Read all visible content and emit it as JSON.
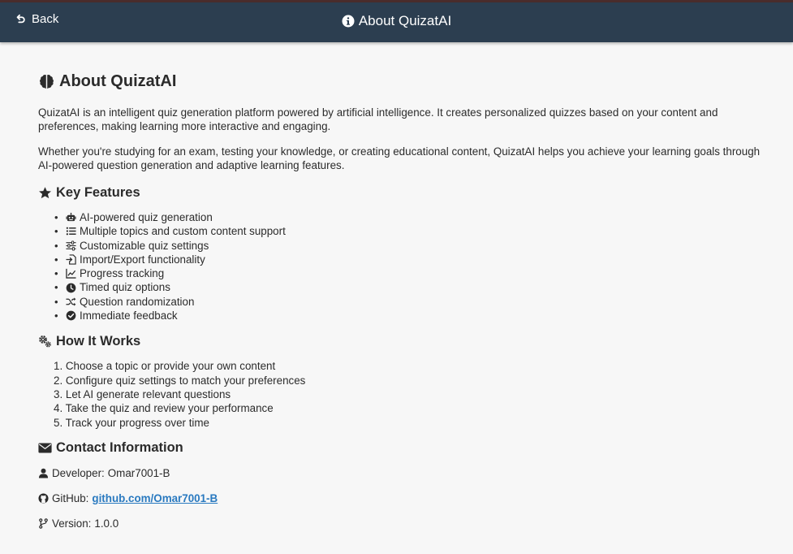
{
  "header": {
    "back_label": "Back",
    "title": "About QuizatAI"
  },
  "main": {
    "title": "About QuizatAI",
    "intro_1": "QuizatAI is an intelligent quiz generation platform powered by artificial intelligence. It creates personalized quizzes based on your content and preferences, making learning more interactive and engaging.",
    "intro_2": "Whether you're studying for an exam, testing your knowledge, or creating educational content, QuizatAI helps you achieve your learning goals through AI-powered question generation and adaptive learning features."
  },
  "features": {
    "heading": "Key Features",
    "items": [
      {
        "icon": "robot-icon",
        "label": "AI-powered quiz generation"
      },
      {
        "icon": "list-icon",
        "label": "Multiple topics and custom content support"
      },
      {
        "icon": "sliders-icon",
        "label": "Customizable quiz settings"
      },
      {
        "icon": "file-import-icon",
        "label": "Import/Export functionality"
      },
      {
        "icon": "chart-line-icon",
        "label": "Progress tracking"
      },
      {
        "icon": "clock-icon",
        "label": "Timed quiz options"
      },
      {
        "icon": "shuffle-icon",
        "label": "Question randomization"
      },
      {
        "icon": "check-circle-icon",
        "label": "Immediate feedback"
      }
    ]
  },
  "how": {
    "heading": "How It Works",
    "steps": [
      "1. Choose a topic or provide your own content",
      "2. Configure quiz settings to match your preferences",
      "3. Let AI generate relevant questions",
      "4. Take the quiz and review your performance",
      "5. Track your progress over time"
    ]
  },
  "contact": {
    "heading": "Contact Information",
    "developer_label": "Developer:",
    "developer_name": "Omar7001-B",
    "github_label": "GitHub:",
    "github_link": "github.com/Omar7001-B",
    "version_label": "Version:",
    "version_value": "1.0.0"
  },
  "colors": {
    "header_bg": "#2c3e50",
    "page_bg": "#f7f7f7",
    "link": "#2a7ac0"
  }
}
